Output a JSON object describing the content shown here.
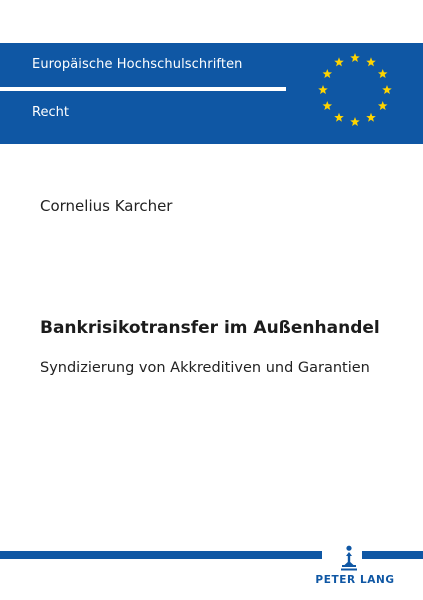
{
  "banner": {
    "series": "Europäische Hochschulschriften",
    "subseries": "Recht",
    "star_color": "#ffd400",
    "background_color": "#0f57a4",
    "emblem": "eu-stars-icon"
  },
  "book": {
    "author": "Cornelius Karcher",
    "title": "Bankrisikotransfer im Außenhandel",
    "subtitle": "Syndizierung von Akkreditiven und Garantien"
  },
  "publisher": {
    "name": "PETER LANG",
    "logo": "peter-lang-logo-icon"
  }
}
